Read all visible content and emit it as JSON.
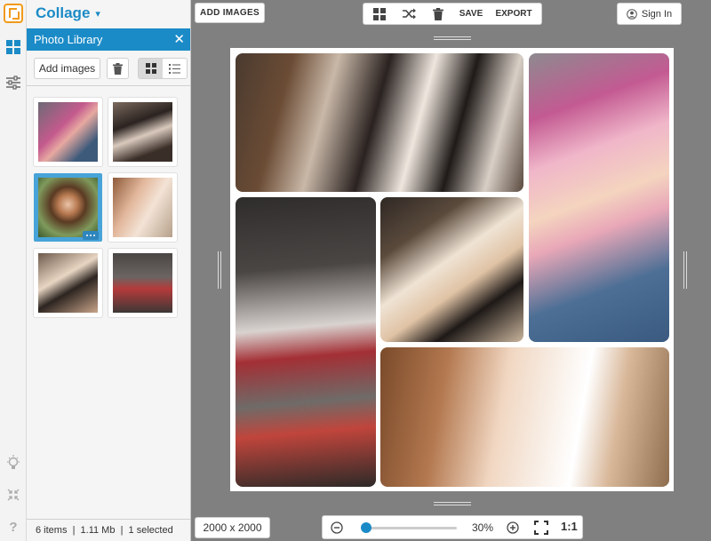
{
  "app": {
    "title": "Collage"
  },
  "rail": {
    "items": [
      "logo-icon",
      "layout-icon",
      "adjust-icon",
      "lightbulb-icon",
      "collapse-icon",
      "help-icon"
    ],
    "help_label": "?"
  },
  "panel": {
    "title": "Photo Library",
    "close_label": "✕",
    "add_images_label": "Add images"
  },
  "thumbnails": [
    {
      "name": "woman-pink-hair"
    },
    {
      "name": "woman-reclining-phone"
    },
    {
      "name": "woman-glasses-outdoor",
      "selected": true
    },
    {
      "name": "woman-white-flowers"
    },
    {
      "name": "woman-lying-hat"
    },
    {
      "name": "ballet-dancers"
    }
  ],
  "status": {
    "text": "6 items  |  1.11 Mb  |  1 selected"
  },
  "toolbar": {
    "add_images_label": "ADD IMAGES",
    "save_label": "SAVE",
    "export_label": "EXPORT",
    "signin_label": "Sign In"
  },
  "canvas_size": "2000 x 2000",
  "zoom": {
    "value_label": "30%",
    "actual_size_label": "1:1",
    "level": 0.3
  },
  "colors": {
    "accent": "#1b8bc7",
    "brand_orange": "#f29a1a",
    "workspace": "#808080"
  }
}
